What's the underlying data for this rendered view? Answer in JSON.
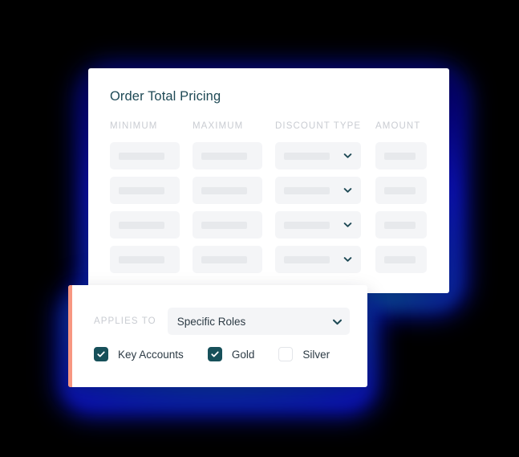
{
  "colors": {
    "accent_coral": "#f79781",
    "checkbox_teal": "#17505a",
    "title_text": "#1f4a56",
    "label_grey": "#c9ccd2",
    "field_bg": "#f4f5f7",
    "skeleton_bg": "#e7e9ec",
    "glow_blue": "#0b11b5",
    "glow_teal": "#0e7f92",
    "card_bg": "#ffffff",
    "page_bg": "#000000"
  },
  "pricing_card": {
    "title": "Order Total Pricing",
    "columns": [
      {
        "key": "minimum",
        "label": "MINIMUM"
      },
      {
        "key": "maximum",
        "label": "MAXIMUM"
      },
      {
        "key": "discount_type",
        "label": "DISCOUNT TYPE"
      },
      {
        "key": "amount",
        "label": "AMOUNT"
      }
    ],
    "rows": [
      {
        "minimum": "",
        "maximum": "",
        "discount_type": "",
        "amount": ""
      },
      {
        "minimum": "",
        "maximum": "",
        "discount_type": "",
        "amount": ""
      },
      {
        "minimum": "",
        "maximum": "",
        "discount_type": "",
        "amount": ""
      },
      {
        "minimum": "",
        "maximum": "",
        "discount_type": "",
        "amount": ""
      }
    ],
    "row_count": 4,
    "discount_type_icon": "chevron-down-icon"
  },
  "applies_card": {
    "label": "APPLIES TO",
    "select": {
      "value": "Specific Roles",
      "icon": "chevron-down-icon"
    },
    "checkboxes": [
      {
        "label": "Key Accounts",
        "checked": true
      },
      {
        "label": "Gold",
        "checked": true
      },
      {
        "label": "Silver",
        "checked": false
      }
    ]
  }
}
